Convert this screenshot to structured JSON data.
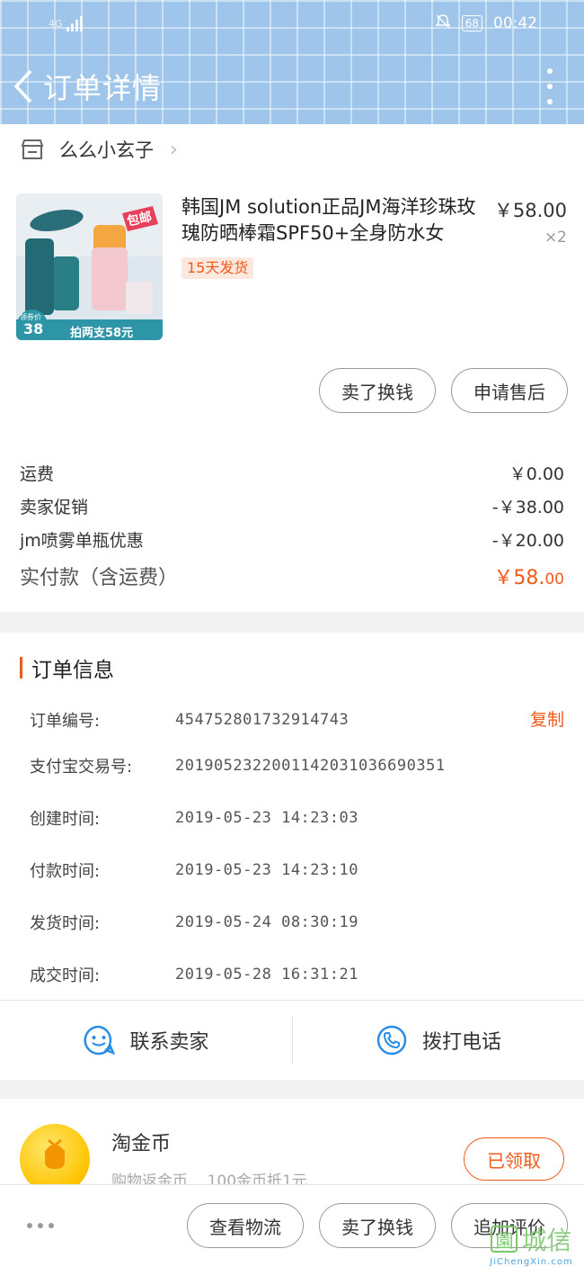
{
  "status_bar": {
    "network": "4G",
    "battery": "68",
    "time": "00:42"
  },
  "header": {
    "title": "订单详情"
  },
  "shop": {
    "name": "么么小玄子"
  },
  "product": {
    "title": "韩国JM solution正品JM海洋珍珠玫瑰防晒棒霜SPF50+全身防水女",
    "price": "￥58.00",
    "quantity": "×2",
    "shipping_tag": "15天发货",
    "image_badge": "包邮",
    "image_caption": "拍两支58元",
    "image_price_label": "领券价",
    "image_price": "38"
  },
  "item_actions": {
    "sell_label": "卖了换钱",
    "after_sale_label": "申请售后"
  },
  "fees": [
    {
      "label": "运费",
      "value": "￥0.00"
    },
    {
      "label": "卖家促销",
      "value": "-￥38.00"
    },
    {
      "label": "jm喷雾单瓶优惠",
      "value": "-￥20.00"
    }
  ],
  "total": {
    "label": "实付款（含运费）",
    "value_main": "￥58.",
    "value_cents": "00"
  },
  "order_info": {
    "title": "订单信息",
    "copy_label": "复制",
    "rows": [
      {
        "label": "订单编号:",
        "value": "454752801732914743"
      },
      {
        "label": "支付宝交易号:",
        "value": "2019052322001142031036690351"
      },
      {
        "label": "创建时间:",
        "value": "2019-05-23 14:23:03"
      },
      {
        "label": "付款时间:",
        "value": "2019-05-23 14:23:10"
      },
      {
        "label": "发货时间:",
        "value": "2019-05-24 08:30:19"
      },
      {
        "label": "成交时间:",
        "value": "2019-05-28 16:31:21"
      }
    ]
  },
  "contact": {
    "seller_label": "联系卖家",
    "call_label": "拨打电话"
  },
  "coins": {
    "title": "淘金币",
    "subtitle": "购物返金币    100金币抵1元",
    "claimed_label": "已领取"
  },
  "bottom_bar": {
    "logistics_label": "查看物流",
    "sell_label": "卖了换钱",
    "review_label": "追加评价"
  },
  "watermark": {
    "text": "城信",
    "url": "JiChengXin.com"
  },
  "colors": {
    "accent": "#f05a1a",
    "header_bg": "#9fc6ea",
    "link_blue": "#2a8ee6"
  }
}
